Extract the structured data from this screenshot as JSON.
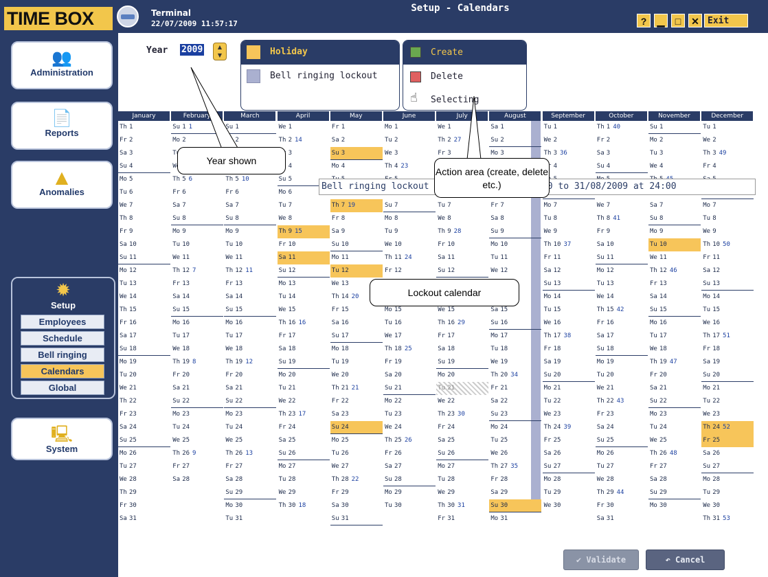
{
  "app": {
    "brand": "TIME BOX",
    "terminal_label": "Terminal",
    "datetime": "22/07/2009 11:57:17",
    "screen_title": "Setup - Calendars",
    "help": "?",
    "exit": "Exit"
  },
  "sidebar": {
    "administration": "Administration",
    "reports": "Reports",
    "anomalies": "Anomalies",
    "setup": "Setup",
    "setup_items": [
      "Employees",
      "Schedule",
      "Bell ringing",
      "Calendars",
      "Global"
    ],
    "system": "System"
  },
  "year": {
    "label": "Year",
    "value": "2009"
  },
  "legend": {
    "holiday": "Holiday",
    "lockout": "Bell ringing lockout"
  },
  "actions": {
    "create": "Create",
    "delete": "Delete",
    "selecting": "Selecting"
  },
  "lockout_text": "Bell ringing lockout on 01/08/2009 at 00:00 to 31/08/2009 at 24:00",
  "callouts": {
    "year": "Year shown",
    "actions": "Action area (create, delete etc.)",
    "lockout": "Lockout calendar"
  },
  "buttons": {
    "validate": "Validate",
    "cancel": "Cancel"
  },
  "colors": {
    "navy": "#2a3c66",
    "holiday": "#f7c55a",
    "lockout": "#aab0d0",
    "selected": "#c8cfdf"
  },
  "calendar": {
    "months": [
      "January",
      "February",
      "March",
      "April",
      "May",
      "June",
      "July",
      "August",
      "September",
      "October",
      "November",
      "December"
    ],
    "first_weekday": [
      3,
      6,
      6,
      2,
      4,
      0,
      2,
      5,
      1,
      3,
      6,
      1
    ],
    "days_in_month": [
      31,
      28,
      31,
      30,
      31,
      30,
      31,
      31,
      30,
      31,
      30,
      31
    ],
    "weekday_abbr": [
      "Mo",
      "Tu",
      "We",
      "Th",
      "Fr",
      "Sa",
      "Su"
    ],
    "week_numbers": [
      [
        1,
        1,
        1
      ],
      [
        1,
        5,
        6
      ],
      [
        1,
        12,
        7
      ],
      [
        1,
        19,
        8
      ],
      [
        1,
        26,
        9
      ],
      [
        2,
        5,
        10
      ],
      [
        2,
        12,
        11
      ],
      [
        2,
        19,
        12
      ],
      [
        2,
        26,
        13
      ],
      [
        3,
        2,
        14
      ],
      [
        3,
        9,
        15
      ],
      [
        3,
        16,
        16
      ],
      [
        3,
        23,
        17
      ],
      [
        3,
        30,
        18
      ],
      [
        4,
        7,
        19
      ],
      [
        4,
        14,
        20
      ],
      [
        4,
        21,
        21
      ],
      [
        4,
        28,
        22
      ],
      [
        5,
        4,
        23
      ],
      [
        5,
        11,
        24
      ],
      [
        5,
        18,
        25
      ],
      [
        5,
        25,
        26
      ],
      [
        6,
        2,
        27
      ],
      [
        6,
        9,
        28
      ],
      [
        6,
        16,
        29
      ],
      [
        6,
        23,
        30
      ],
      [
        6,
        30,
        31
      ],
      [
        7,
        6,
        32
      ],
      [
        7,
        13,
        33
      ],
      [
        7,
        20,
        34
      ],
      [
        7,
        27,
        35
      ],
      [
        8,
        3,
        36
      ],
      [
        8,
        10,
        37
      ],
      [
        8,
        17,
        38
      ],
      [
        8,
        24,
        39
      ],
      [
        9,
        1,
        40
      ],
      [
        9,
        8,
        41
      ],
      [
        9,
        15,
        42
      ],
      [
        9,
        22,
        43
      ],
      [
        9,
        29,
        44
      ],
      [
        10,
        5,
        45
      ],
      [
        10,
        12,
        46
      ],
      [
        10,
        19,
        47
      ],
      [
        10,
        26,
        48
      ],
      [
        11,
        3,
        49
      ],
      [
        11,
        10,
        50
      ],
      [
        11,
        17,
        51
      ],
      [
        11,
        24,
        52
      ],
      [
        11,
        31,
        53
      ]
    ],
    "holidays": [
      [
        4,
        3
      ],
      [
        4,
        7
      ],
      [
        3,
        9
      ],
      [
        3,
        11
      ],
      [
        4,
        12
      ],
      [
        4,
        24
      ],
      [
        10,
        10
      ],
      [
        11,
        24
      ],
      [
        11,
        25
      ],
      [
        7,
        30
      ]
    ],
    "selected_day": [
      0,
      0
    ],
    "hatched_day": [
      6,
      21
    ]
  }
}
